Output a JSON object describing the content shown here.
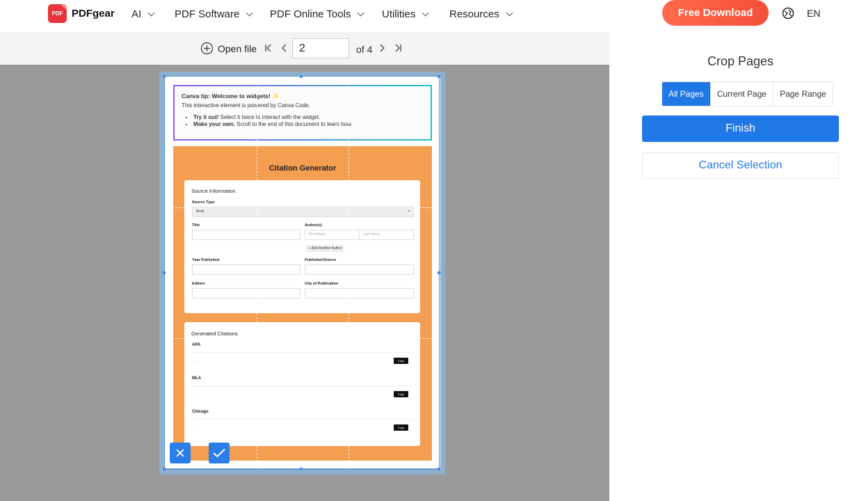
{
  "brand": {
    "name": "PDFgear",
    "logo_text": "PDF",
    "color": "#e8353a"
  },
  "nav": {
    "items": [
      {
        "label": "AI"
      },
      {
        "label": "PDF Software"
      },
      {
        "label": "PDF Online Tools"
      },
      {
        "label": "Utilities"
      },
      {
        "label": "Resources"
      }
    ],
    "cta": "Free Download",
    "language": "EN"
  },
  "toolbar": {
    "open_file": "Open file",
    "page_value": "2",
    "page_total": "of 4"
  },
  "document": {
    "tip": {
      "title": "Canva tip: Welcome to widgets! ✨",
      "body": "This interactive element is powered by Canva Code.",
      "bullet1_strong": "Try it out!",
      "bullet1_rest": " Select it twice to interact with the widget.",
      "bullet2_strong": "Make your own.",
      "bullet2_rest": " Scroll to the end of this document to learn how."
    },
    "generator_title": "Citation Generator",
    "source": {
      "heading": "Source Information",
      "source_type_label": "Source Type",
      "source_type_value": "Book",
      "title_label": "Title",
      "authors_label": "Author(s)",
      "first_name_placeholder": "First Name",
      "last_name_placeholder": "Last Name",
      "add_author": "+ Add Another Author",
      "year_label": "Year Published",
      "publisher_label": "Publisher/Source",
      "edition_label": "Edition",
      "city_label": "City of Publication"
    },
    "citations": {
      "heading": "Generated Citations",
      "placeholder": "...",
      "copy_label": "Copy",
      "styles": [
        {
          "label": "APA"
        },
        {
          "label": "MLA"
        },
        {
          "label": "Chicago"
        }
      ]
    }
  },
  "panel": {
    "title": "Crop Pages",
    "scope_options": [
      "All Pages",
      "Current Page",
      "Page Range"
    ],
    "selected_scope": "All Pages",
    "finish": "Finish",
    "cancel": "Cancel Selection"
  },
  "colors": {
    "accent": "#1f78e6",
    "cta": "#f4503a",
    "orange_widget": "#f39e51"
  }
}
